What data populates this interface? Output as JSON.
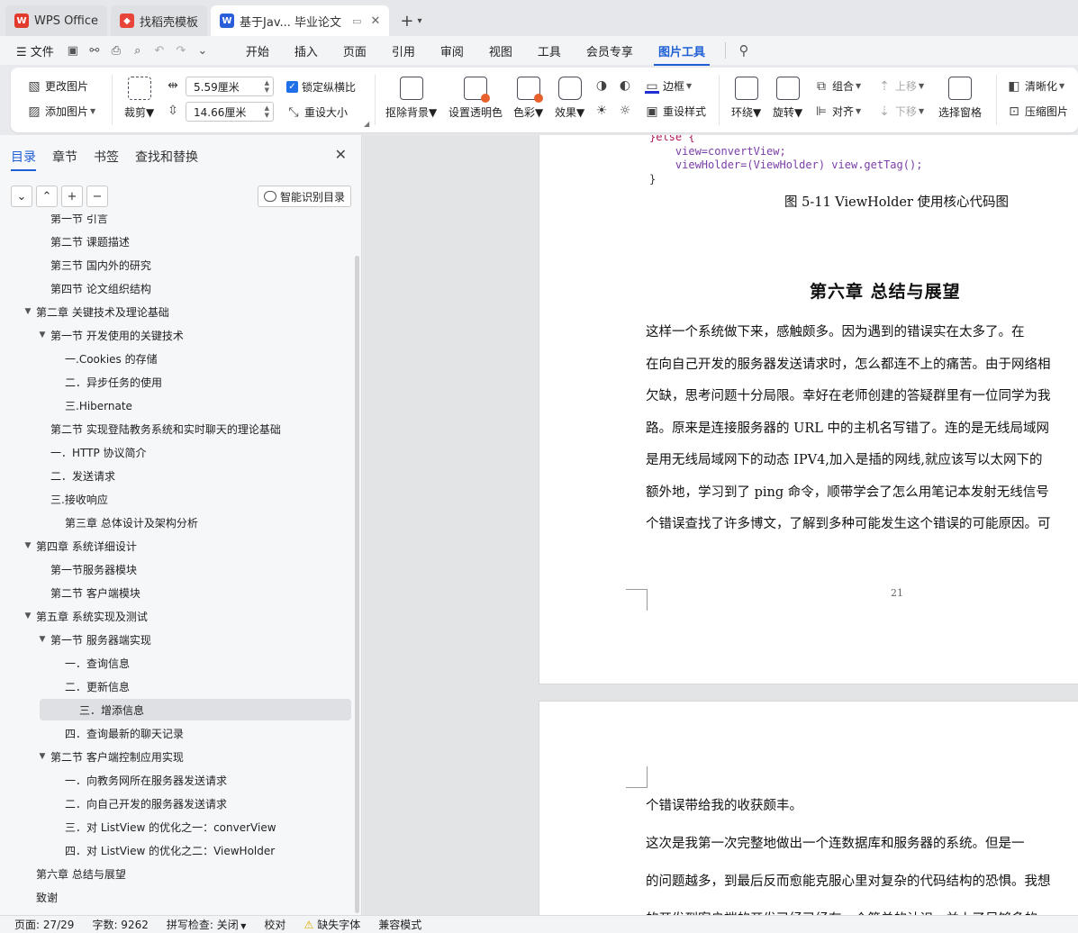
{
  "tabs": [
    {
      "label": "WPS Office",
      "icon": "wps-logo-icon",
      "color": "#e23b2e"
    },
    {
      "label": "找稻壳模板",
      "icon": "docer-logo-icon",
      "color": "#e8443a"
    },
    {
      "label": "基于Jav... 毕业论文",
      "icon": "word-doc-icon",
      "color": "#2b5fd9"
    }
  ],
  "menubar": {
    "file": "文件",
    "items": [
      "开始",
      "插入",
      "页面",
      "引用",
      "审阅",
      "视图",
      "工具",
      "会员专享",
      "图片工具"
    ],
    "active": "图片工具"
  },
  "ribbon": {
    "change_image": "更改图片",
    "add_image": "添加图片",
    "crop": "裁剪",
    "width_value": "5.59厘米",
    "height_value": "14.66厘米",
    "lock_ratio": "锁定纵横比",
    "reset_size": "重设大小",
    "remove_bg": "抠除背景",
    "set_transparent": "设置透明色",
    "color": "色彩",
    "effects": "效果",
    "border": "边框",
    "reset_style": "重设样式",
    "wrap": "环绕",
    "rotate": "旋转",
    "group": "组合",
    "align": "对齐",
    "move_up": "上移",
    "move_down": "下移",
    "selection_pane": "选择窗格",
    "sharpen": "清晰化",
    "compress": "压缩图片"
  },
  "pane": {
    "tabs": [
      "目录",
      "章节",
      "书签",
      "查找和替换"
    ],
    "active_tab": "目录",
    "smart_toc": "智能识别目录",
    "toc": [
      {
        "label": "第一节   引言",
        "level": 2,
        "arrow": ""
      },
      {
        "label": "第二节  课题描述",
        "level": 2,
        "arrow": ""
      },
      {
        "label": "第三节  国内外的研究",
        "level": 2,
        "arrow": ""
      },
      {
        "label": "第四节  论文组织结构",
        "level": 2,
        "arrow": ""
      },
      {
        "label": "第二章  关键技术及理论基础",
        "level": 1,
        "arrow": "▼"
      },
      {
        "label": "第一节  开发使用的关键技术",
        "level": 2,
        "arrow": "▼"
      },
      {
        "label": "一.Cookies 的存储",
        "level": 3,
        "arrow": ""
      },
      {
        "label": "二．异步任务的使用",
        "level": 3,
        "arrow": ""
      },
      {
        "label": "三.Hibernate",
        "level": 3,
        "arrow": ""
      },
      {
        "label": "第二节  实现登陆教务系统和实时聊天的理论基础",
        "level": 2,
        "arrow": ""
      },
      {
        "label": "一．HTTP 协议简介",
        "level": 2,
        "arrow": ""
      },
      {
        "label": "二．发送请求",
        "level": 2,
        "arrow": ""
      },
      {
        "label": "三.接收响应",
        "level": 2,
        "arrow": ""
      },
      {
        "label": "第三章  总体设计及架构分析",
        "level": 3,
        "arrow": ""
      },
      {
        "label": "第四章  系统详细设计",
        "level": 1,
        "arrow": "▼"
      },
      {
        "label": "第一节服务器模块",
        "level": 2,
        "arrow": ""
      },
      {
        "label": "第二节  客户端模块",
        "level": 2,
        "arrow": ""
      },
      {
        "label": "第五章  系统实现及测试",
        "level": 1,
        "arrow": "▼"
      },
      {
        "label": "第一节  服务器端实现",
        "level": 2,
        "arrow": "▼"
      },
      {
        "label": "一．查询信息",
        "level": 3,
        "arrow": ""
      },
      {
        "label": "二．更新信息",
        "level": 3,
        "arrow": ""
      },
      {
        "label": "三．增添信息",
        "level": 3,
        "arrow": "",
        "selected": true
      },
      {
        "label": "四．查询最新的聊天记录",
        "level": 3,
        "arrow": ""
      },
      {
        "label": "第二节  客户端控制应用实现",
        "level": 2,
        "arrow": "▼"
      },
      {
        "label": "一．向教务网所在服务器发送请求",
        "level": 3,
        "arrow": ""
      },
      {
        "label": "二．向自己开发的服务器发送请求",
        "level": 3,
        "arrow": ""
      },
      {
        "label": "三．对 ListView 的优化之一：converView",
        "level": 3,
        "arrow": ""
      },
      {
        "label": "四．对 ListView 的优化之二：ViewHolder",
        "level": 3,
        "arrow": ""
      },
      {
        "label": "第六章  总结与展望",
        "level": 1,
        "arrow": ""
      },
      {
        "label": "致谢",
        "level": 1,
        "arrow": ""
      }
    ]
  },
  "document": {
    "code_lines": [
      "}else {",
      "    view=convertView;",
      "    viewHolder=(ViewHolder) view.getTag();",
      "}"
    ],
    "caption": "图 5-11 ViewHolder 使用核心代码图",
    "heading": "第六章    总结与展望",
    "paragraph_lines": [
      "      这样一个系统做下来，感触颇多。因为遇到的错误实在太多了。在",
      "在向自己开发的服务器发送请求时，怎么都连不上的痛苦。由于网络相",
      "欠缺，思考问题十分局限。幸好在老师创建的答疑群里有一位同学为我",
      "路。原来是连接服务器的 URL 中的主机名写错了。连的是无线局域网",
      "是用无线局域网下的动态 IPV4,加入是插的网线,就应该写以太网下的",
      "额外地，学习到了 ping 命令，顺带学会了怎么用笔记本发射无线信号",
      "个错误查找了许多博文，了解到多种可能发生这个错误的可能原因。可"
    ],
    "page_number": "21",
    "page2_lines": [
      "个错误带给我的收获颇丰。",
      "      这次是我第一次完整地做出一个连数据库和服务器的系统。但是一",
      "的问题越多，到最后反而愈能克服心里对复杂的代码结构的恐惧。我想",
      "的开发到客户端的开发已经已经有一个简单的认识，并上了足够多的"
    ]
  },
  "statusbar": {
    "page": "页面: 27/29",
    "words": "字数: 9262",
    "spell": "拼写检查: 关闭",
    "proof": "校对",
    "missing_font": "缺失字体",
    "compat": "兼容模式"
  }
}
